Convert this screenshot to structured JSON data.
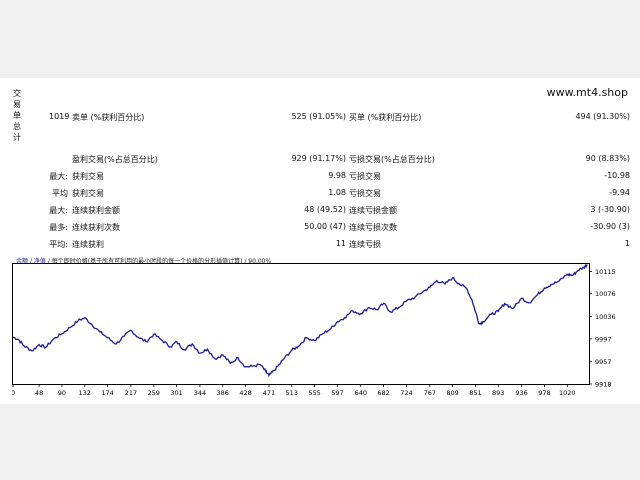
{
  "window": {
    "title_chars": [
      "交",
      "易",
      "单",
      "总",
      "计"
    ],
    "brand": "www.mt4.shop"
  },
  "stats": {
    "row1": {
      "c1_value": "1019",
      "c1_label": "卖单 (%获利百分比)",
      "c2_value": "525 (91.05%)",
      "c2_label": "买单 (%获利百分比)",
      "c3_value": "494 (91.30%)"
    },
    "row2": {
      "c1_label": "盈利交易(%占总百分比)",
      "c2_value": "929 (91.17%)",
      "c2_label": "亏损交易(%占总百分比)",
      "c3_value": "90 (8.83%)"
    },
    "row3": {
      "prefix": "最大:",
      "c1_label": "获利交易",
      "c2_value": "9.98",
      "c2_label": "亏损交易",
      "c3_value": "-10.98"
    },
    "row4": {
      "prefix": "平均",
      "c1_label": "获利交易",
      "c2_value": "1.08",
      "c2_label": "亏损交易",
      "c3_value": "-9.94"
    },
    "row5": {
      "prefix": "最大:",
      "c1_label": "连续获利金额",
      "c2_value": "48 (49.52)",
      "c2_label": "连续亏损金额",
      "c3_value": "3 (-30.90)"
    },
    "row6": {
      "prefix": "最多:",
      "c1_label": "连续获利次数",
      "c2_value": "50.00 (47)",
      "c2_label": "连续亏损次数",
      "c3_value": "-30.90 (3)"
    },
    "row7": {
      "prefix": "平均:",
      "c1_label": "连续获利",
      "c2_value": "11",
      "c2_label": "连续亏损",
      "c3_value": "1"
    }
  },
  "chart_header": {
    "tab1": "余额",
    "sep1": "/",
    "tab2": "净值",
    "sep2": "/",
    "text": "每个即时价格(基于所有可利用的最小时段的每一个价格的分形插值计算) / 90.00%"
  },
  "chart_data": {
    "type": "line",
    "title": "",
    "xlabel": "",
    "ylabel": "",
    "x_ticks": [
      0,
      48,
      90,
      132,
      174,
      217,
      259,
      301,
      344,
      386,
      428,
      471,
      513,
      555,
      597,
      640,
      682,
      724,
      767,
      809,
      851,
      893,
      936,
      978,
      1020
    ],
    "y_ticks": [
      9918,
      9957,
      9997,
      10036,
      10076,
      10115
    ],
    "xlim": [
      0,
      1060
    ],
    "ylim": [
      9918,
      10128
    ],
    "grid": false,
    "color": "#1a1a9c",
    "series": [
      {
        "x": [
          0,
          10,
          20,
          35,
          48,
          60,
          75,
          90,
          105,
          120,
          132,
          145,
          160,
          174,
          190,
          205,
          217,
          230,
          245,
          259,
          275,
          290,
          301,
          315,
          330,
          344,
          358,
          372,
          386,
          400,
          414,
          428,
          440,
          455,
          465,
          471,
          480,
          490,
          500,
          513,
          525,
          540,
          555,
          570,
          585,
          597,
          610,
          625,
          640,
          655,
          670,
          682,
          695,
          710,
          724,
          740,
          755,
          767,
          780,
          795,
          809,
          820,
          835,
          845,
          851,
          858,
          865,
          880,
          893,
          905,
          920,
          936,
          950,
          965,
          978,
          990,
          1005,
          1020,
          1030,
          1040,
          1050,
          1057
        ],
        "values": [
          10000,
          9996,
          9985,
          9976,
          9987,
          9982,
          9997,
          10006,
          10017,
          10029,
          10034,
          10022,
          10009,
          9999,
          9988,
          10002,
          10012,
          10000,
          9992,
          10005,
          9994,
          9983,
          9992,
          9978,
          9988,
          9972,
          9979,
          9962,
          9969,
          9954,
          9964,
          9948,
          9949,
          9952,
          9940,
          9933,
          9941,
          9952,
          9964,
          9977,
          9984,
          9999,
          9994,
          10006,
          10015,
          10027,
          10034,
          10046,
          10041,
          10052,
          10048,
          10059,
          10044,
          10052,
          10063,
          10070,
          10080,
          10087,
          10099,
          10093,
          10104,
          10094,
          10085,
          10064,
          10045,
          10023,
          10027,
          10040,
          10045,
          10059,
          10050,
          10068,
          10060,
          10074,
          10086,
          10092,
          10098,
          10110,
          10108,
          10117,
          10122,
          10127
        ]
      }
    ]
  }
}
